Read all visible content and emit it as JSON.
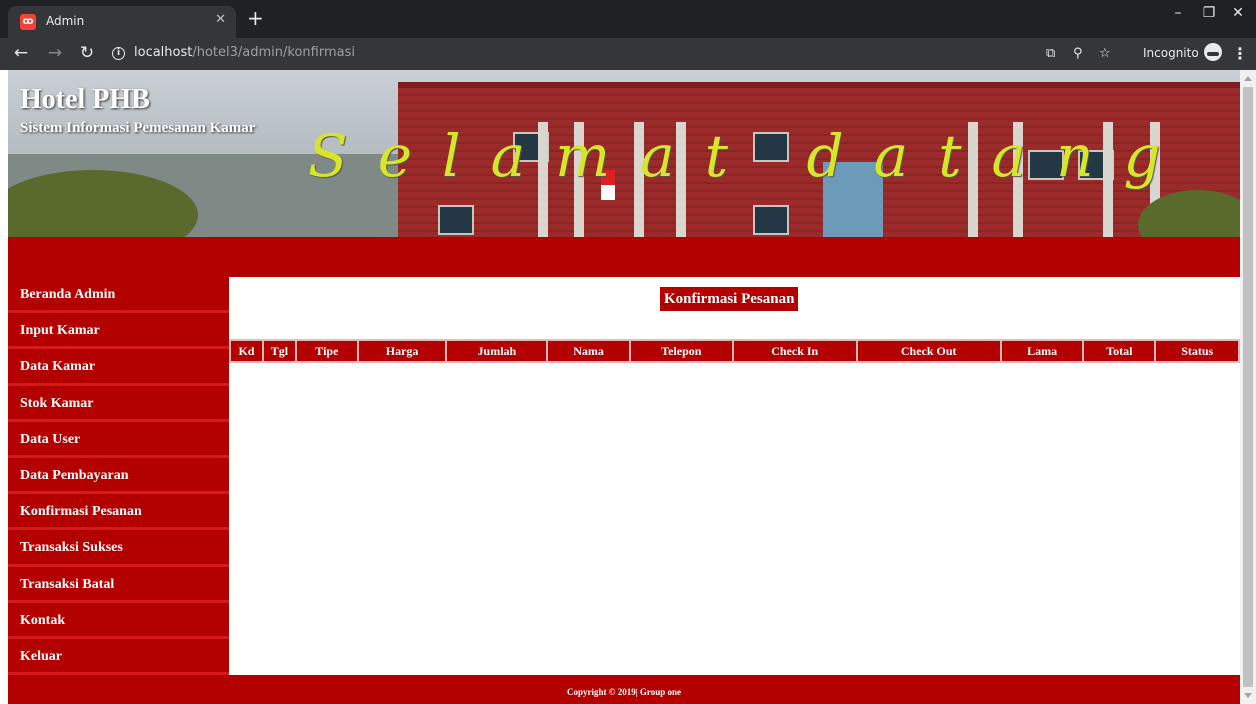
{
  "browser": {
    "tab_title": "Admin",
    "tab_favicon": "xampp-icon",
    "url_host": "localhost",
    "url_path": "/hotel3/admin/konfirmasi",
    "incognito_label": "Incognito"
  },
  "header": {
    "site_title": "Hotel PHB",
    "site_subtitle": "Sistem Informasi Pemesanan Kamar",
    "welcome_text": "Selamat datang"
  },
  "sidebar": {
    "items": [
      {
        "label": "Beranda Admin"
      },
      {
        "label": "Input Kamar"
      },
      {
        "label": "Data Kamar"
      },
      {
        "label": "Stok Kamar"
      },
      {
        "label": "Data User"
      },
      {
        "label": "Data Pembayaran"
      },
      {
        "label": "Konfirmasi Pesanan"
      },
      {
        "label": "Transaksi Sukses"
      },
      {
        "label": "Transaksi Batal"
      },
      {
        "label": "Kontak"
      },
      {
        "label": "Keluar"
      }
    ]
  },
  "main": {
    "title": "Konfirmasi Pesanan",
    "columns": [
      "Kd",
      "Tgl",
      "Tipe",
      "Harga",
      "Jumlah",
      "Nama",
      "Telepon",
      "Check In",
      "Check Out",
      "Lama",
      "Total",
      "Status"
    ],
    "rows": []
  },
  "footer": {
    "copyright": "Copyright © 2019| Group one"
  },
  "colors": {
    "primary_red": "#b30000",
    "welcome_yellow": "#d8e62a"
  }
}
